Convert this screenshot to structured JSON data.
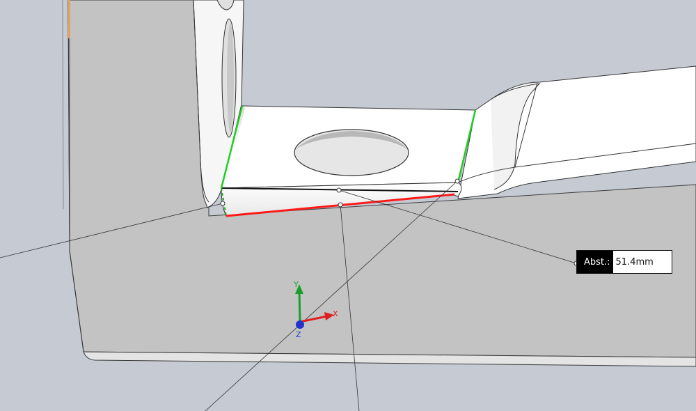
{
  "measurement": {
    "label": "Abst.:",
    "value": "51.4mm"
  },
  "triad": {
    "x_label": "X",
    "y_label": "Y",
    "z_label": "Z",
    "x_color": "#e02020",
    "y_color": "#1a9e2a",
    "z_color": "#2233cc"
  },
  "colors": {
    "background": "#c5cad3",
    "face_gray": "#c3c3c3",
    "face_white": "#ffffff",
    "selected_edge": "#ff0000",
    "highlight_edge": "#00cc00"
  }
}
